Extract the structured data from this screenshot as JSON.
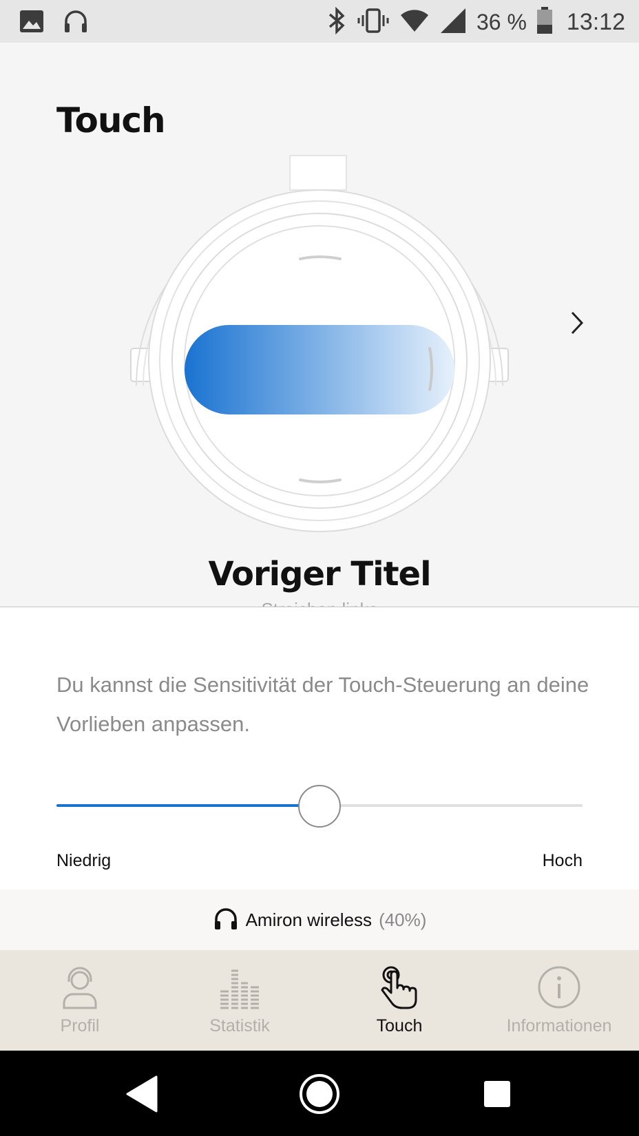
{
  "status_bar": {
    "battery_percent": "36 %",
    "time": "13:12",
    "left_icons": [
      "image-icon",
      "headphones-icon"
    ],
    "right_icons": [
      "bluetooth-icon",
      "vibrate-icon",
      "wifi-icon",
      "signal-icon",
      "battery-icon"
    ]
  },
  "page": {
    "title": "Touch"
  },
  "gesture": {
    "title": "Voriger Titel",
    "subtitle": "Streichen links",
    "gradient_start": "#1a73d1",
    "gradient_end": "#e6f0fb"
  },
  "sensitivity": {
    "description": "Du kannst die Sensitivität der Touch-Steuerung an deine Vorlieben anpassen.",
    "value": 0.5,
    "label_low": "Niedrig",
    "label_high": "Hoch",
    "accent": "#1a73d1"
  },
  "device": {
    "name": "Amiron wireless",
    "battery": "(40%)"
  },
  "tabs": [
    {
      "label": "Profil",
      "icon": "profile-icon",
      "active": false
    },
    {
      "label": "Statistik",
      "icon": "statistics-icon",
      "active": false
    },
    {
      "label": "Touch",
      "icon": "touch-icon",
      "active": true
    },
    {
      "label": "Informationen",
      "icon": "info-icon",
      "active": false
    }
  ],
  "android_nav": [
    "back-icon",
    "home-icon",
    "recents-icon"
  ]
}
